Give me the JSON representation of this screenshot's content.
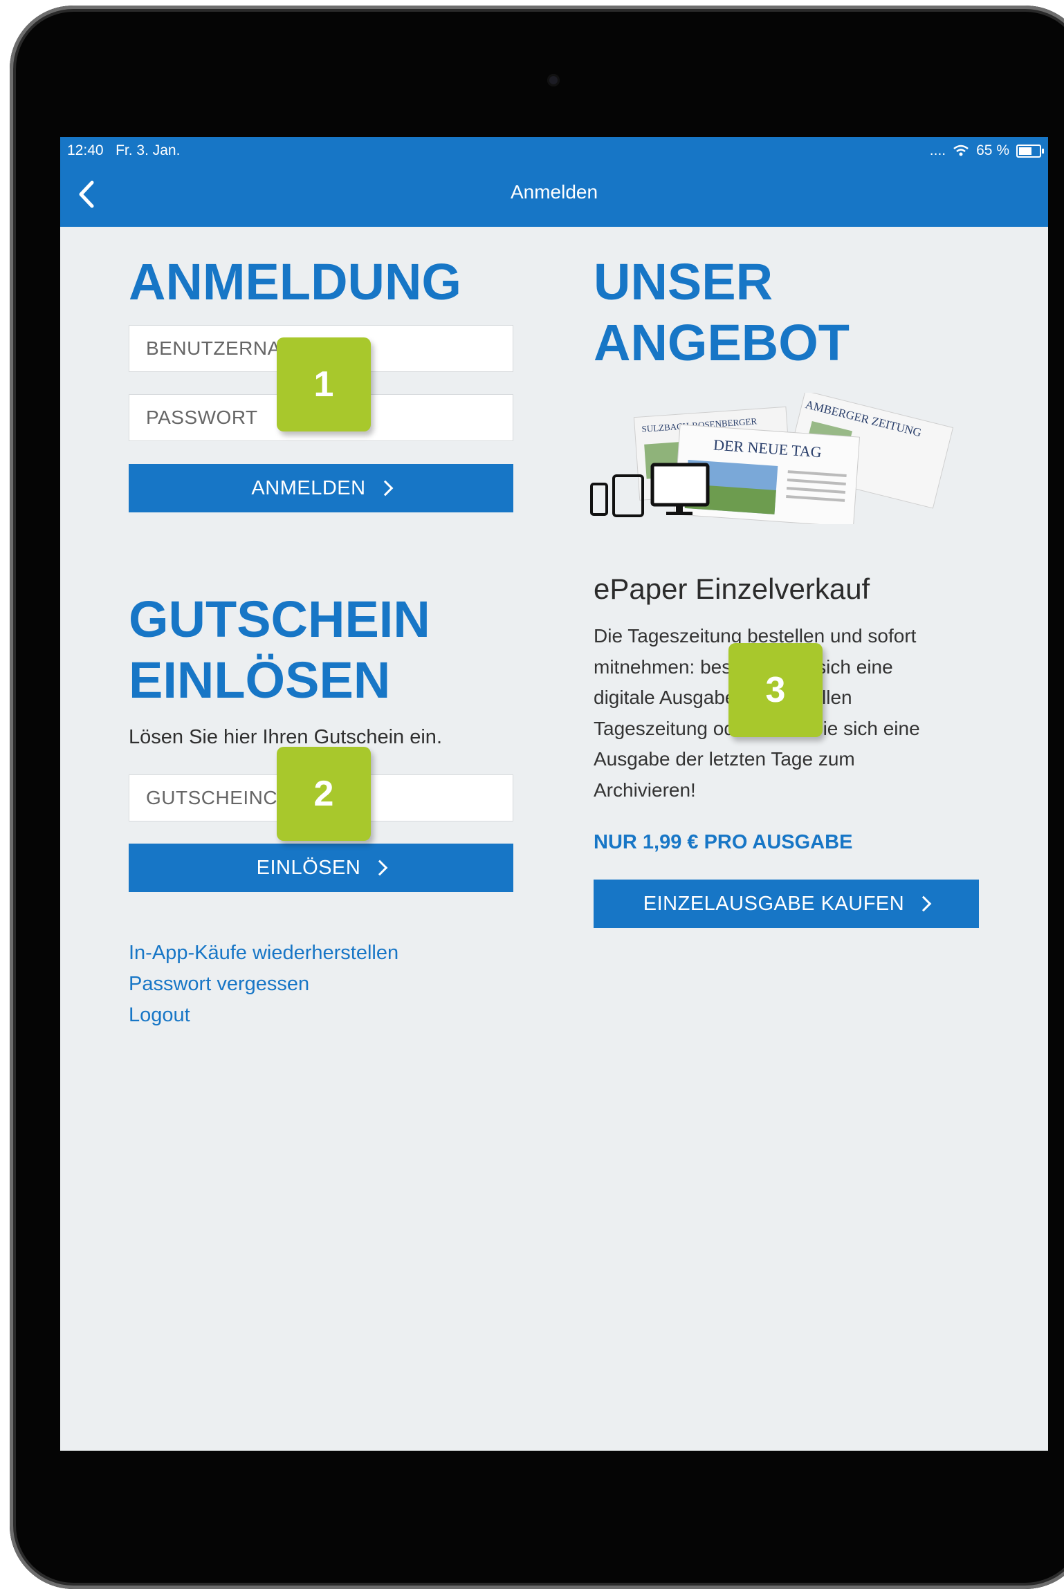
{
  "status_bar": {
    "time": "12:40",
    "date": "Fr. 3. Jan.",
    "signal": "....",
    "battery": "65 %"
  },
  "nav": {
    "title": "Anmelden"
  },
  "login": {
    "heading": "ANMELDUNG",
    "username_placeholder": "BENUTZERNAME",
    "password_placeholder": "PASSWORT",
    "submit_label": "ANMELDEN"
  },
  "voucher": {
    "heading_line1": "GUTSCHEIN",
    "heading_line2": "EINLÖSEN",
    "description": "Lösen Sie hier Ihren Gutschein ein.",
    "code_placeholder": "GUTSCHEINCODE",
    "submit_label": "EINLÖSEN"
  },
  "links": {
    "restore": "In-App-Käufe wiederherstellen",
    "forgot": "Passwort vergessen",
    "logout": "Logout"
  },
  "offer": {
    "heading_line1": "UNSER",
    "heading_line2": "ANGEBOT",
    "paper1": "SULZBACH-ROSENBERGER",
    "paper2": "AMBERGER ZEITUNG",
    "paper3": "DER NEUE TAG",
    "product_title": "ePaper Einzelverkauf",
    "description_lines": [
      "Die Tageszeitung bestellen und sofort",
      "mitnehmen: bestellen Sie sich eine",
      "digitale Ausgabe der aktuellen",
      "Tageszeitung oder holen Sie sich eine",
      "Ausgabe der letzten Tage zum",
      "Archivieren!"
    ],
    "price": "NUR 1,99 € PRO AUSGABE",
    "buy_label": "EINZELAUSGABE KAUFEN"
  },
  "markers": [
    "1",
    "2",
    "3"
  ],
  "colors": {
    "accent": "#1776c6",
    "marker": "#a8c82c",
    "background": "#eceff1"
  }
}
